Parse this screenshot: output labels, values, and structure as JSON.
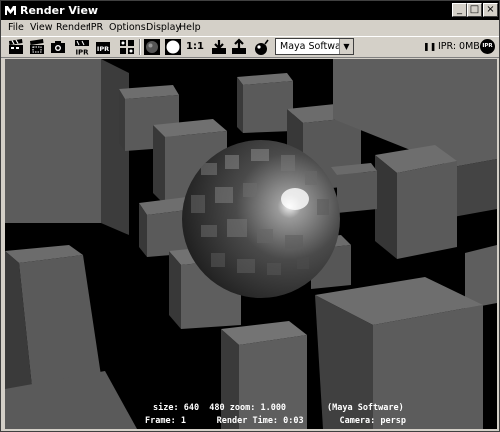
{
  "window": {
    "title": "Render View",
    "minimize_glyph": "_",
    "maximize_glyph": "□",
    "close_glyph": "×"
  },
  "menu": [
    "File",
    "View",
    "Render",
    "IPR",
    "Options",
    "Display",
    "Help"
  ],
  "toolbar": {
    "icons": [
      "render-clapper-icon",
      "render-region-icon",
      "snapshot-camera-icon",
      "ipr-render-icon",
      "ipr-refresh-icon",
      "render-options-icon",
      "rgb-channel-icon",
      "alpha-channel-icon",
      "keep-image-icon",
      "remove-image-icon",
      "material-sphere-icon"
    ],
    "zoom_label": "1:1",
    "renderer_selected": "Maya Software",
    "pause_glyph": "❚❚",
    "ipr_memory": "IPR: 0MB",
    "ipr_badge": "IPR"
  },
  "render_info": {
    "line1": "size: 640  480 zoom: 1.000        (Maya Software)",
    "line2": "Frame: 1      Render Time: 0:03       Camera: persp"
  },
  "colors": {
    "title_bar": "#000000",
    "chrome": "#d4d0c8",
    "viewport_bg": "#000000",
    "cube_face": "#5a5a5a",
    "info_text": "#ffffff"
  }
}
